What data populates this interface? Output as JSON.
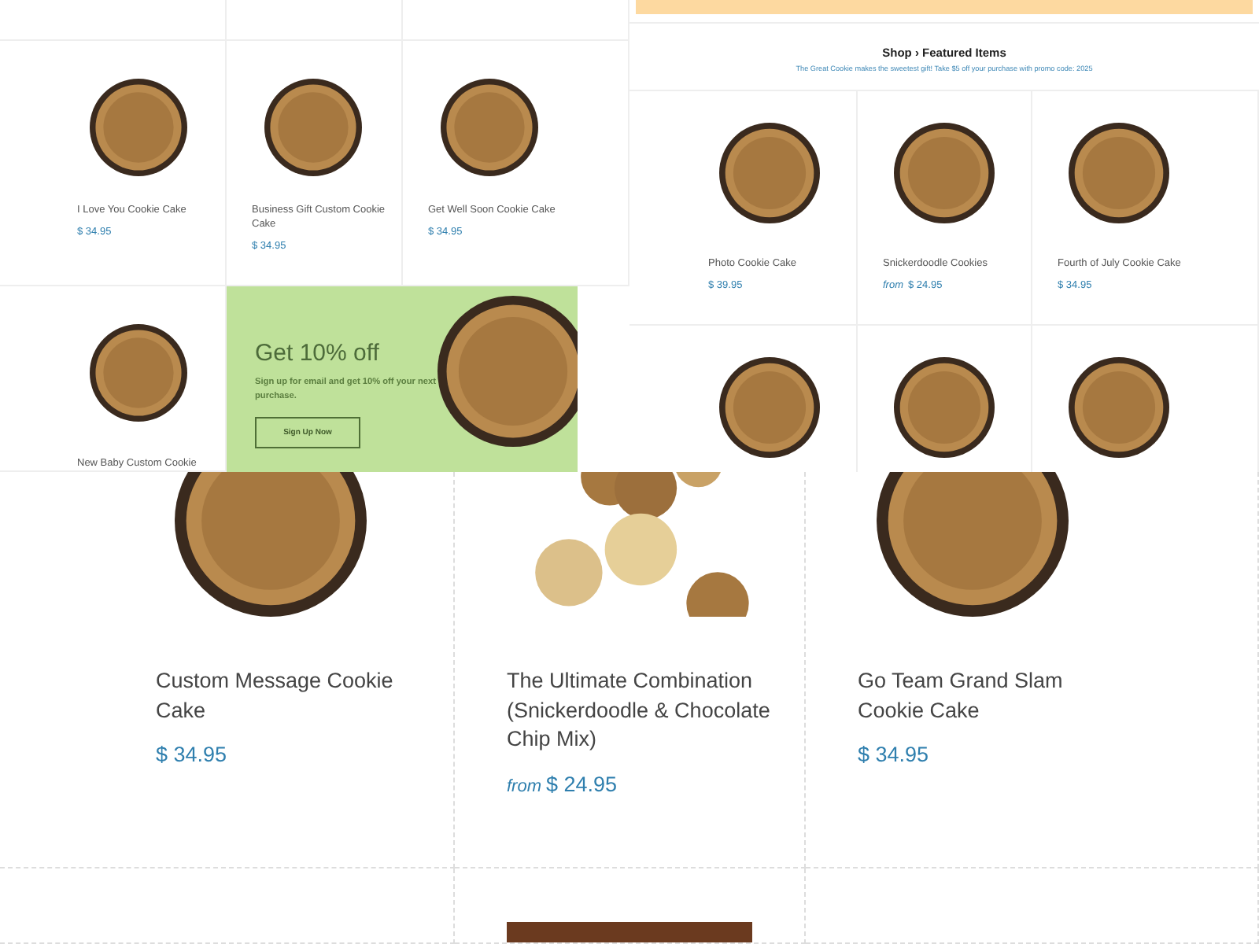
{
  "catalog_left": {
    "products": [
      {
        "kind": "round",
        "name": "I Love You Cookie Cake",
        "price": "$ 34.95"
      },
      {
        "kind": "round",
        "name": "Business Gift Custom Cookie Cake",
        "price": "$ 34.95"
      },
      {
        "kind": "round",
        "name": "Get Well Soon Cookie Cake",
        "price": "$ 34.95"
      },
      {
        "kind": "round",
        "name": "New Baby Custom Cookie"
      },
      {
        "kind": "promo",
        "title": "Get 10% off",
        "text": "Sign up for email and get 10% off your next purchase.",
        "button": "Sign Up Now"
      }
    ]
  },
  "featured": {
    "title": "Shop › Featured Items",
    "subtitle": "The Great Cookie makes the sweetest gift! Take $5 off your purchase with promo code: 2025",
    "products": [
      {
        "kind": "round",
        "name": "Photo Cookie Cake",
        "price": "$ 39.95"
      },
      {
        "kind": "round",
        "name": "Snickerdoodle Cookies",
        "price_prefix": "from",
        "price": "$ 24.95"
      },
      {
        "kind": "round",
        "name": "Fourth of July Cookie Cake",
        "price": "$ 34.95"
      },
      {
        "kind": "round"
      },
      {
        "kind": "round"
      },
      {
        "kind": "round"
      }
    ]
  },
  "catalog_bottom": {
    "products": [
      {
        "kind": "round",
        "name": "Custom Message Cookie Cake",
        "price": "$ 34.95"
      },
      {
        "kind": "cluster",
        "name": "The Ultimate Combination (Snickerdoodle & Chocolate Chip Mix)",
        "price_prefix": "from",
        "price": "$ 24.95"
      },
      {
        "kind": "round",
        "name": "Go Team Grand Slam Cookie Cake",
        "price": "$ 34.95"
      },
      {
        "kind": "blank"
      },
      {
        "kind": "rect"
      },
      {
        "kind": "blank"
      }
    ]
  }
}
